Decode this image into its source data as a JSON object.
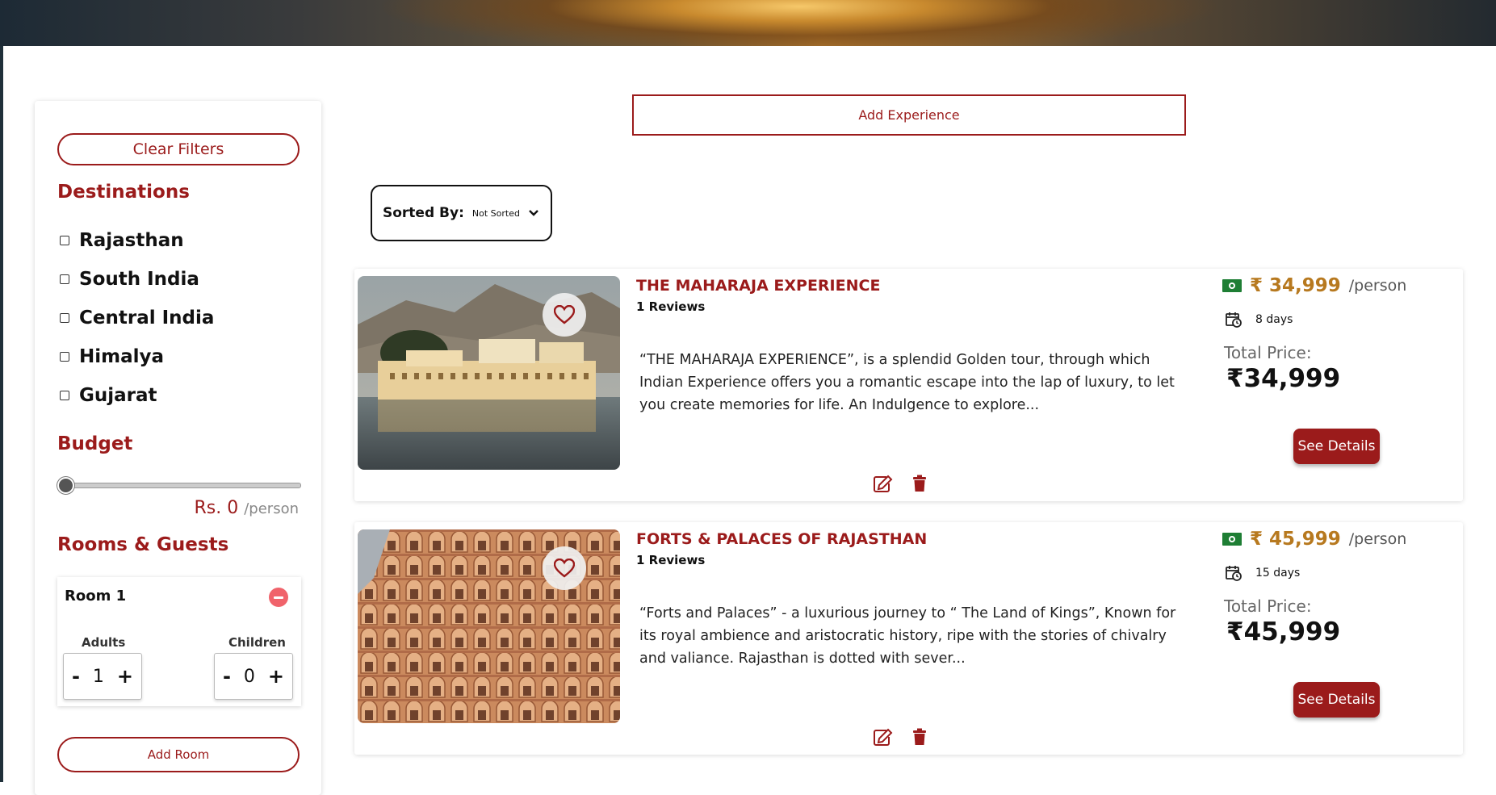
{
  "colors": {
    "accent": "#9b1b1b",
    "price": "#b7791f",
    "money_icon": "#1e7e34"
  },
  "sidebar": {
    "clear_filters": "Clear Filters",
    "destinations_title": "Destinations",
    "destinations": [
      "Rajasthan",
      "South India",
      "Central India",
      "Himalya",
      "Gujarat"
    ],
    "budget_title": "Budget",
    "budget_value": "Rs. 0",
    "budget_unit": "/person",
    "budget_slider_fraction": 0,
    "rooms_title": "Rooms & Guests",
    "room": {
      "label": "Room 1",
      "adults_label": "Adults",
      "adults_value": "1",
      "children_label": "Children",
      "children_value": "0",
      "minus": "-",
      "plus": "+"
    },
    "add_room": "Add Room"
  },
  "main": {
    "add_experience": "Add Experience",
    "sort_label": "Sorted By:",
    "sort_value": "Not Sorted",
    "cards": [
      {
        "title": "THE MAHARAJA EXPERIENCE",
        "reviews": "1 Reviews",
        "description": "“THE MAHARAJA EXPERIENCE”, is a splendid Golden tour, through which Indian Experience offers you a romantic escape into the lap of luxury, to let you create memories for life. An Indulgence to explore...",
        "price": "₹ 34,999",
        "per": "/person",
        "days": "8 days",
        "total_label": "Total Price:",
        "total": "₹34,999",
        "button": "See Details"
      },
      {
        "title": "FORTS & PALACES OF RAJASTHAN",
        "reviews": "1 Reviews",
        "description": "“Forts and Palaces” - a luxurious journey to “ The Land of Kings”, Known for its royal ambience and aristocratic history, ripe with the stories of chivalry and valiance. Rajasthan is dotted with sever...",
        "price": "₹ 45,999",
        "per": "/person",
        "days": "15 days",
        "total_label": "Total Price:",
        "total": "₹45,999",
        "button": "See Details"
      }
    ]
  }
}
